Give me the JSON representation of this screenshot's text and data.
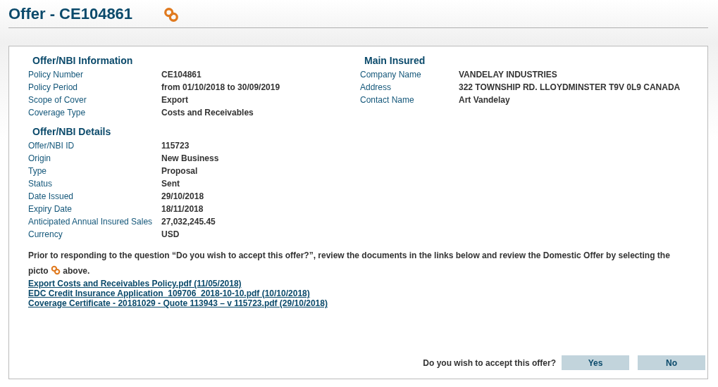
{
  "title": "Offer - CE104861",
  "info": {
    "heading": "Offer/NBI Information",
    "rows": [
      {
        "label": "Policy Number",
        "value": "CE104861"
      },
      {
        "label": "Policy Period",
        "value": "from 01/10/2018 to 30/09/2019"
      },
      {
        "label": "Scope of Cover",
        "value": "Export"
      },
      {
        "label": "Coverage Type",
        "value": "Costs and Receivables"
      }
    ]
  },
  "details": {
    "heading": "Offer/NBI Details",
    "rows": [
      {
        "label": "Offer/NBI ID",
        "value": "115723"
      },
      {
        "label": "Origin",
        "value": "New Business"
      },
      {
        "label": "Type",
        "value": "Proposal"
      },
      {
        "label": "Status",
        "value": "Sent"
      },
      {
        "label": "Date Issued",
        "value": "29/10/2018"
      },
      {
        "label": "Expiry Date",
        "value": "18/11/2018"
      },
      {
        "label": "Anticipated Annual Insured Sales",
        "value": "27,032,245.45"
      },
      {
        "label": "Currency",
        "value": "USD"
      }
    ]
  },
  "insured": {
    "heading": "Main Insured",
    "rows": [
      {
        "label": "Company Name",
        "value": "VANDELAY INDUSTRIES"
      },
      {
        "label": "Address",
        "value": "322 TOWNSHIP RD. LLOYDMINSTER T9V 0L9 CANADA"
      },
      {
        "label": "Contact Name",
        "value": "Art Vandelay"
      }
    ]
  },
  "note": {
    "line": "Prior to responding to the question “Do you wish to accept this offer?”, review the documents in the links below and review the Domestic Offer by selecting the",
    "before": "picto",
    "after": "above."
  },
  "documents": [
    "Export Costs and Receivables Policy.pdf (11/05/2018)",
    "EDC Credit Insurance Application_109706_2018-10-10.pdf (10/10/2018)",
    "Coverage Certificate - 20181029 - Quote 113943 – v 115723.pdf (29/10/2018)"
  ],
  "question": "Do you wish to accept this offer?",
  "buttons": [
    "Yes",
    "No"
  ]
}
